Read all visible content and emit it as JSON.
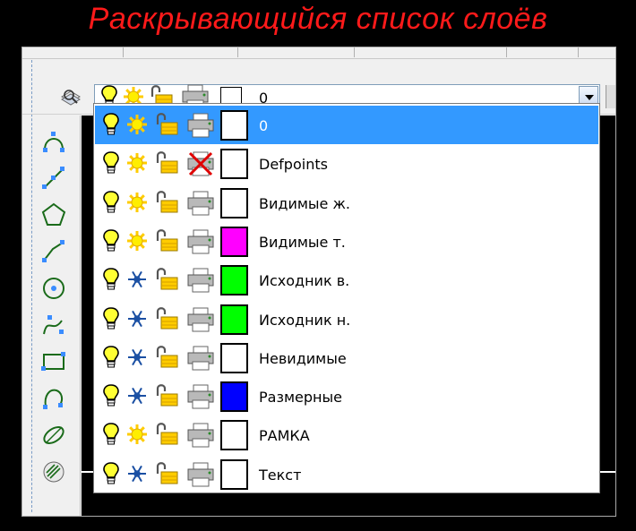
{
  "title": "Раскрывающийся список слоёв",
  "combo": {
    "selected_name": "0",
    "selected_color": "#ffffff",
    "icons": [
      "lightbulb-on-icon",
      "sun-thawed-icon",
      "padlock-unlocked-icon",
      "printer-icon"
    ]
  },
  "layers": [
    {
      "name": "0",
      "on": true,
      "frozen": false,
      "locked": false,
      "plot": true,
      "color": "#ffffff",
      "selected": true
    },
    {
      "name": "Defpoints",
      "on": true,
      "frozen": false,
      "locked": false,
      "plot": false,
      "color": "#ffffff",
      "selected": false
    },
    {
      "name": "Видимые ж.",
      "on": true,
      "frozen": false,
      "locked": false,
      "plot": true,
      "color": "#ffffff",
      "selected": false
    },
    {
      "name": "Видимые т.",
      "on": true,
      "frozen": false,
      "locked": false,
      "plot": true,
      "color": "#ff00ff",
      "selected": false
    },
    {
      "name": "Исходник в.",
      "on": true,
      "frozen": true,
      "locked": false,
      "plot": true,
      "color": "#00ff00",
      "selected": false
    },
    {
      "name": "Исходник н.",
      "on": true,
      "frozen": true,
      "locked": false,
      "plot": true,
      "color": "#00ff00",
      "selected": false
    },
    {
      "name": "Невидимые",
      "on": true,
      "frozen": true,
      "locked": false,
      "plot": true,
      "color": "#ffffff",
      "selected": false
    },
    {
      "name": "Размерные",
      "on": true,
      "frozen": true,
      "locked": false,
      "plot": true,
      "color": "#0000ff",
      "selected": false
    },
    {
      "name": "РАМКА",
      "on": true,
      "frozen": false,
      "locked": false,
      "plot": true,
      "color": "#ffffff",
      "selected": false
    },
    {
      "name": "Текст",
      "on": true,
      "frozen": true,
      "locked": false,
      "plot": true,
      "color": "#ffffff",
      "selected": false
    }
  ],
  "tools": [
    "arc-icon",
    "line-icon",
    "polygon-icon",
    "polyline-icon",
    "circle-icon",
    "spline-icon",
    "rectangle-icon",
    "arc-3point-icon",
    "ellipse-icon",
    "hatch-icon"
  ],
  "colors": {
    "title": "#ff1a1a",
    "selection": "#3399ff"
  }
}
